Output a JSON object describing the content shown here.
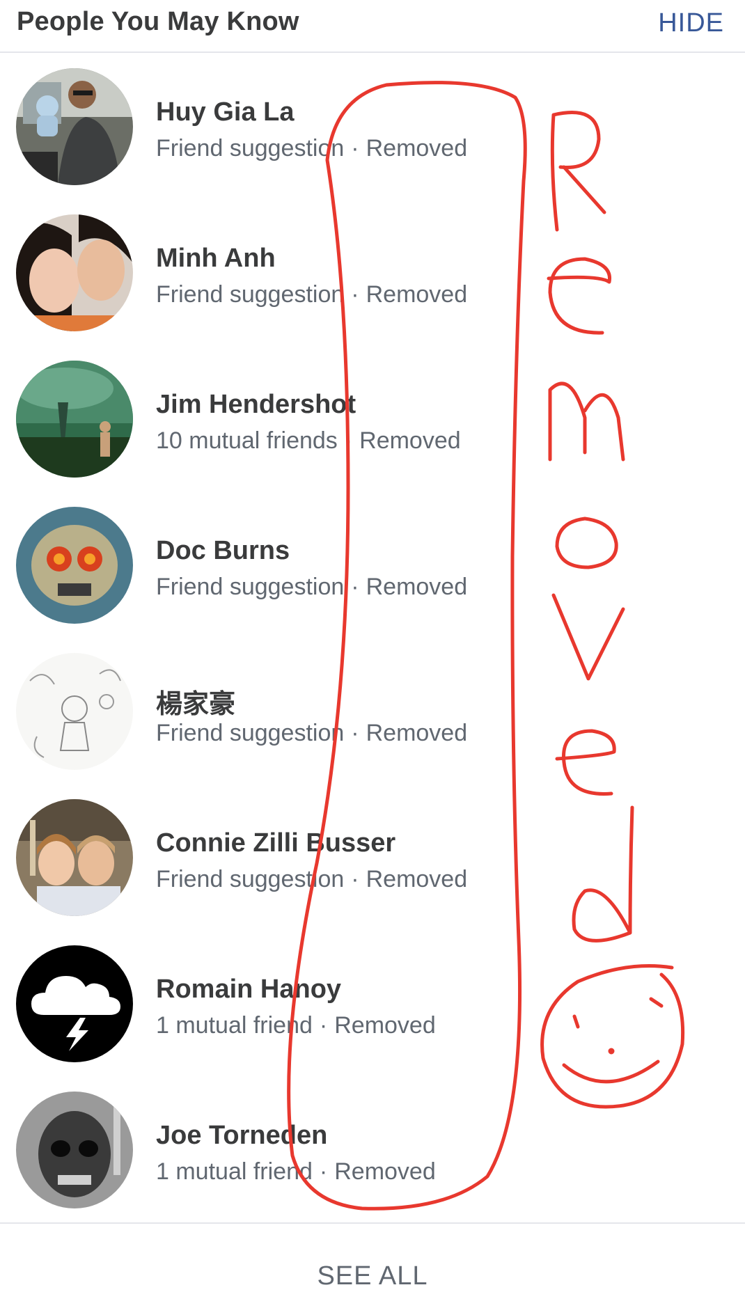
{
  "header": {
    "title": "People You May Know",
    "hide_label": "HIDE"
  },
  "people": [
    {
      "name": "Huy Gia La",
      "subtitle": "Friend suggestion",
      "status": "Removed",
      "avatar": "avatar-photo-man-in-car"
    },
    {
      "name": "Minh Anh",
      "subtitle": "Friend suggestion",
      "status": "Removed",
      "avatar": "avatar-photo-couple-selfie"
    },
    {
      "name": "Jim Hendershot",
      "subtitle": "10 mutual friends",
      "status": "Removed",
      "avatar": "avatar-photo-tornado-field"
    },
    {
      "name": "Doc Burns",
      "subtitle": "Friend suggestion",
      "status": "Removed",
      "avatar": "avatar-photo-skull-tattoo"
    },
    {
      "name": "楊家豪",
      "subtitle": "Friend suggestion",
      "status": "Removed",
      "avatar": "avatar-sketch-drawing"
    },
    {
      "name": "Connie Zilli Busser",
      "subtitle": "Friend suggestion",
      "status": "Removed",
      "avatar": "avatar-photo-two-women"
    },
    {
      "name": "Romain Hanoy",
      "subtitle": "1 mutual friend",
      "status": "Removed",
      "avatar": "avatar-storm-cloud-icon"
    },
    {
      "name": "Joe Torneden",
      "subtitle": "1 mutual friend",
      "status": "Removed",
      "avatar": "avatar-photo-skull-face"
    }
  ],
  "separator": "·",
  "footer": {
    "see_all_label": "SEE ALL"
  },
  "annotation": {
    "text": "Removed",
    "color": "#e8382e"
  },
  "colors": {
    "link": "#385898",
    "name": "#3a3b3c",
    "subtle": "#606770",
    "divider": "#e4e6eb"
  }
}
